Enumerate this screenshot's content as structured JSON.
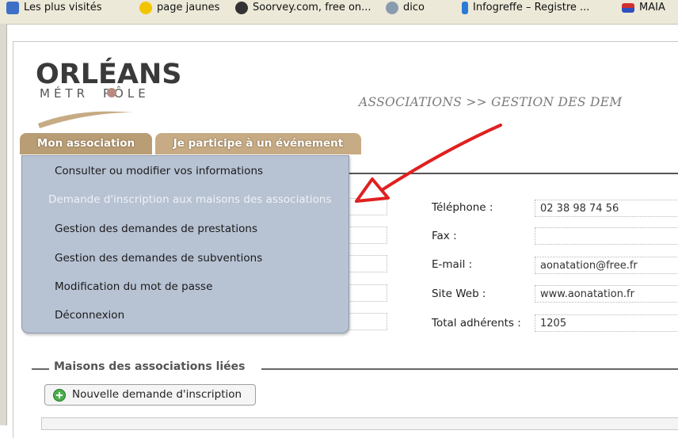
{
  "bookmarks": [
    {
      "label": "Les plus visités",
      "icon": "bookmark-blue-icon",
      "color": "#3d6fc6"
    },
    {
      "label": "page jaunes",
      "icon": "pagesjaunes-icon",
      "color": "#f2c400"
    },
    {
      "label": "Soorvey.com, free on...",
      "icon": "soorvey-icon",
      "color": "#333333"
    },
    {
      "label": "dico",
      "icon": "dico-icon",
      "color": "#8a9bb0"
    },
    {
      "label": "Infogreffe – Registre ...",
      "icon": "infogreffe-icon",
      "color": "#2a7bd4"
    },
    {
      "label": "MAIA",
      "icon": "maia-flag-icon",
      "color": "#d03030"
    }
  ],
  "logo": {
    "name": "ORLÉANS",
    "sub_left": "MÉTR",
    "sub_right": "PÔLE"
  },
  "page_heading": "ASSOCIATIONS >> GESTION DES DEM",
  "tabs": [
    {
      "label": "Mon association"
    },
    {
      "label": "Je participe à un événement"
    }
  ],
  "menu": {
    "items": [
      {
        "label": "Consulter ou modifier vos informations"
      },
      {
        "label": "Demande d'inscription aux maisons des associations",
        "active": true
      },
      {
        "label": "Gestion des demandes de prestations"
      },
      {
        "label": "Gestion des demandes de subventions"
      },
      {
        "label": "Modification du mot de passe"
      },
      {
        "label": "Déconnexion"
      }
    ]
  },
  "contact_fields": [
    {
      "label": "Téléphone :",
      "value": "02 38 98 74 56"
    },
    {
      "label": "Fax :",
      "value": ""
    },
    {
      "label": "E-mail :",
      "value": "aonatation@free.fr"
    },
    {
      "label": "Site Web :",
      "value": "www.aonatation.fr"
    },
    {
      "label": "Total adhérents :",
      "value": "1205"
    }
  ],
  "section": {
    "title": "Maisons des associations liées"
  },
  "new_request_button": "Nouvelle demande d'inscription",
  "colors": {
    "tab": "#c6ab84",
    "menu": "#b7c2d3",
    "arrow": "#e02020"
  }
}
